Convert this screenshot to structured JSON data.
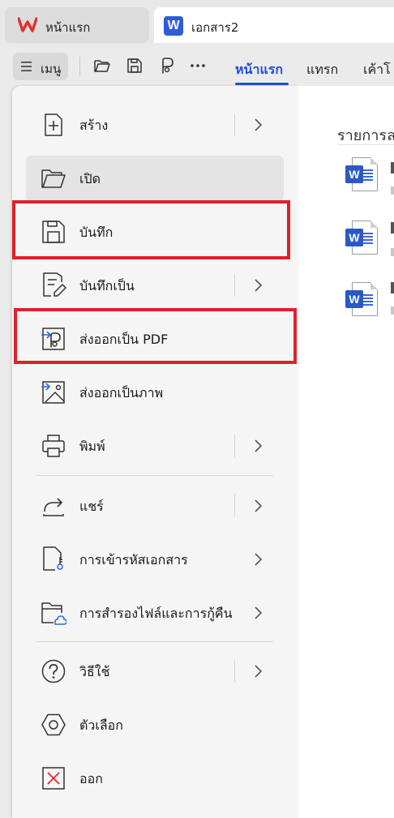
{
  "tabs": [
    {
      "label": "หน้าแรก",
      "icon": "wps-logo-icon"
    },
    {
      "label": "เอกสาร2",
      "icon": "word-doc-icon"
    }
  ],
  "toolbar": {
    "menu_label": "เมนู",
    "ribbon_tabs": [
      "หน้าแรก",
      "แทรก",
      "เค้าโ"
    ],
    "active_tab": "หน้าแรก"
  },
  "menu": {
    "items": [
      {
        "label": "สร้าง",
        "icon": "new-document-icon",
        "has_submenu": true
      },
      {
        "label": "เปิด",
        "icon": "folder-open-icon",
        "has_submenu": false
      },
      {
        "label": "บันทึก",
        "icon": "save-icon",
        "has_submenu": false
      },
      {
        "label": "บันทึกเป็น",
        "icon": "save-as-icon",
        "has_submenu": true
      },
      {
        "label": "ส่งออกเป็น PDF",
        "icon": "export-pdf-icon",
        "has_submenu": false
      },
      {
        "label": "ส่งออกเป็นภาพ",
        "icon": "export-image-icon",
        "has_submenu": false
      },
      {
        "label": "พิมพ์",
        "icon": "printer-icon",
        "has_submenu": true
      },
      {
        "label": "แชร์",
        "icon": "share-icon",
        "has_submenu": true
      },
      {
        "label": "การเข้ารหัสเอกสาร",
        "icon": "encrypt-document-icon",
        "has_submenu": true
      },
      {
        "label": "การสำรองไฟล์และการกู้คืน",
        "icon": "backup-restore-icon",
        "has_submenu": true
      },
      {
        "label": "วิธีใช้",
        "icon": "help-icon",
        "has_submenu": true
      },
      {
        "label": "ตัวเลือก",
        "icon": "options-icon",
        "has_submenu": false
      },
      {
        "label": "ออก",
        "icon": "exit-icon",
        "has_submenu": false
      }
    ],
    "highlighted": [
      "บันทึก",
      "ส่งออกเป็น PDF"
    ]
  },
  "recent": {
    "title": "รายการล",
    "items": [
      "word-doc-icon",
      "word-doc-icon",
      "word-doc-icon"
    ]
  },
  "colors": {
    "accent": "#1e4fd8",
    "highlight_border": "#e0202a",
    "panel_bg": "#f5f5f5",
    "word_blue": "#2a59c6",
    "wps_red": "#e0302c"
  }
}
